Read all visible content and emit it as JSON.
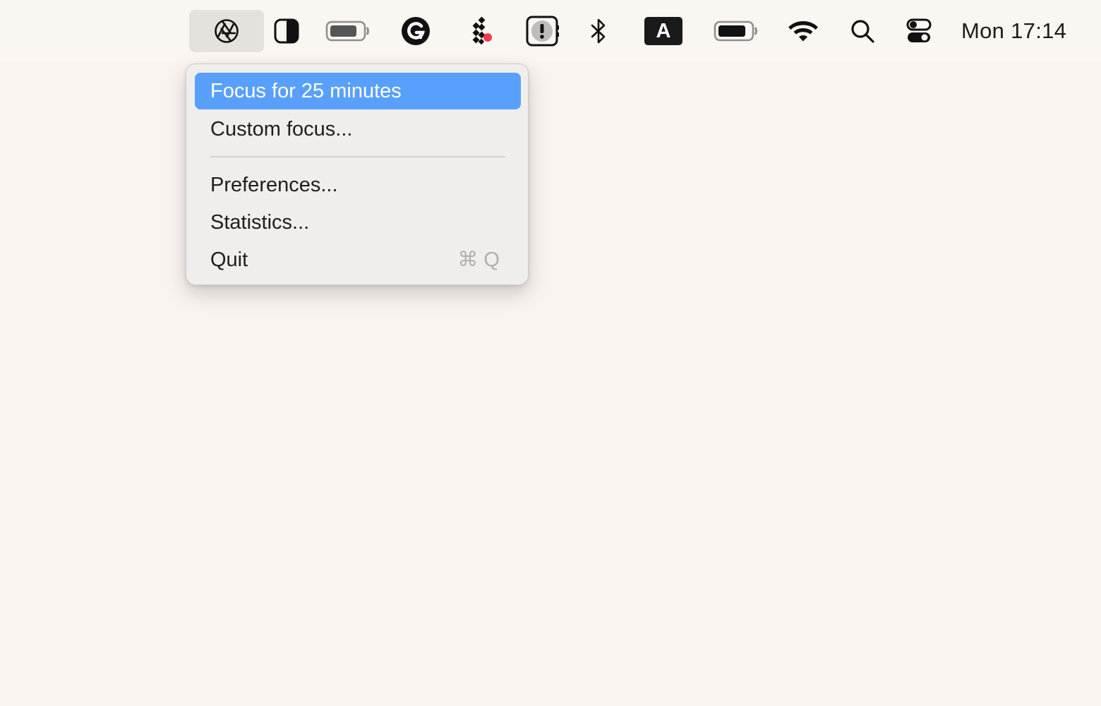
{
  "menubar": {
    "icons": [
      {
        "name": "focus-aperture-icon",
        "active": true
      },
      {
        "name": "contrast-half-icon"
      },
      {
        "name": "battery-icon"
      },
      {
        "name": "grammarly-icon"
      },
      {
        "name": "diamond-grid-icon"
      },
      {
        "name": "alert-badge-icon"
      },
      {
        "name": "bluetooth-icon"
      },
      {
        "name": "input-source-icon"
      },
      {
        "name": "battery-icon"
      },
      {
        "name": "wifi-icon"
      },
      {
        "name": "search-icon"
      },
      {
        "name": "control-center-icon"
      }
    ],
    "input_source_letter": "A",
    "clock": "Mon 17:14"
  },
  "menu": {
    "items": [
      {
        "label": "Focus for 25 minutes",
        "highlighted": true
      },
      {
        "label": "Custom focus..."
      },
      {
        "label": "Preferences..."
      },
      {
        "label": "Statistics..."
      },
      {
        "label": "Quit",
        "shortcut": "⌘ Q"
      }
    ]
  },
  "colors": {
    "highlight": "#58a0fb",
    "desktop": "#f9f4f0",
    "menu_bg": "#f0eeed"
  }
}
